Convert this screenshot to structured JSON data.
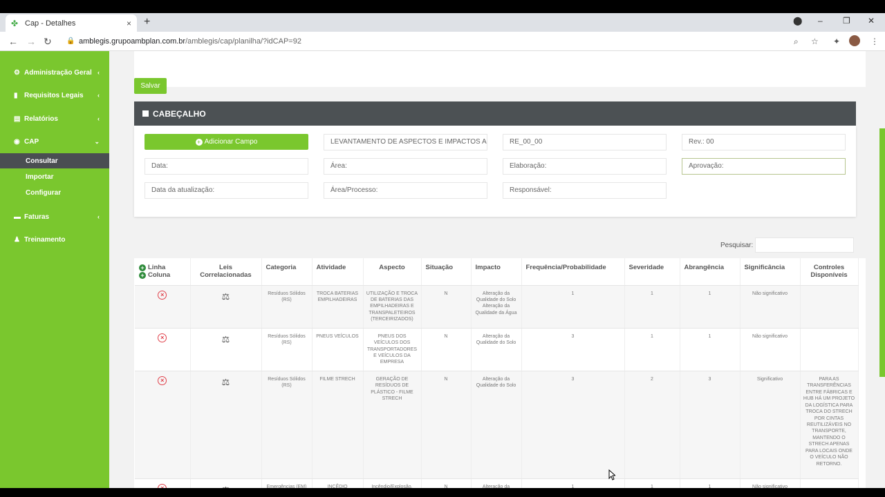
{
  "browser": {
    "tab_title": "Cap - Detalhes",
    "tab_close": "×",
    "new_tab": "+",
    "url_host": "amblegis.grupoambplan.com.br",
    "url_path": "/amblegis/cap/planilha/?idCAP=92",
    "win_min": "–",
    "win_max": "❐",
    "win_close": "✕"
  },
  "sidebar": {
    "items": [
      {
        "label": "Administração Geral",
        "icon": "gear-icon"
      },
      {
        "label": "Requisitos Legais",
        "icon": "bookmark-icon"
      },
      {
        "label": "Relatórios",
        "icon": "report-icon"
      },
      {
        "label": "CAP",
        "icon": "cap-icon"
      },
      {
        "label": "Faturas",
        "icon": "invoice-icon"
      },
      {
        "label": "Treinamento",
        "icon": "user-icon"
      }
    ],
    "cap_sub": [
      "Consultar",
      "Importar",
      "Configurar"
    ]
  },
  "form": {
    "save_label": "Salvar"
  },
  "cabecalho": {
    "title": "CABEÇALHO",
    "add_field_label": "Adicionar Campo",
    "fields": {
      "titulo": "LEVANTAMENTO DE ASPECTOS E IMPACTOS AMBIENTAIS",
      "codigo": "RE_00_00",
      "rev": "Rev.: 00",
      "data": "Data:",
      "area": "Área:",
      "elaboracao": "Elaboração:",
      "aprovacao": "Aprovação:",
      "data_atualizacao": "Data da atualização:",
      "area_processo": "Área/Processo:",
      "responsavel": "Responsável:"
    }
  },
  "table": {
    "search_label": "Pesquisar:",
    "headers": {
      "linha": "Linha",
      "coluna": "Coluna",
      "leis": "Leis Correlacionadas",
      "categoria": "Categoria",
      "atividade": "Atividade",
      "aspecto": "Aspecto",
      "situacao": "Situação",
      "impacto": "Impacto",
      "frequencia": "Frequência/Probabilidade",
      "severidade": "Severidade",
      "abrangencia": "Abrangência",
      "significancia": "Significância",
      "controles": "Controles Disponíveis"
    },
    "rows": [
      {
        "categoria": "Resíduos Sólidos (RS)",
        "atividade": "TROCA BATERIAS EMPILHADEIRAS",
        "aspecto": "UTILIZAÇÃO E TROCA DE BATERIAS DAS EMPILHADEIRAS E TRANSPALETEIROS (TERCEIRIZADOS)",
        "situacao": "N",
        "impacto": "Alteração da Qualidade do Solo Alteração da Qualidade da Água",
        "frequencia": "1",
        "severidade": "1",
        "abrangencia": "1",
        "significancia": "Não significativo",
        "controles": ""
      },
      {
        "categoria": "Resíduos Sólidos (RS)",
        "atividade": "PNEUS VEÍCULOS",
        "aspecto": "PNEUS DOS VEÍCULOS DOS TRANSPORTADORES E VEÍCULOS DA EMPRESA",
        "situacao": "N",
        "impacto": "Alteração da Qualidade do Solo",
        "frequencia": "3",
        "severidade": "1",
        "abrangencia": "1",
        "significancia": "Não significativo",
        "controles": ""
      },
      {
        "categoria": "Resíduos Sólidos (RS)",
        "atividade": "FILME STRECH",
        "aspecto": "GERAÇÃO DE RESÍDUOS DE PLÁSTICO - FILME STRECH",
        "situacao": "N",
        "impacto": "Alteração da Qualidade do Solo",
        "frequencia": "3",
        "severidade": "2",
        "abrangencia": "3",
        "significancia": "Significativo",
        "controles": "PARA AS TRANSFERÊNCIAS ENTRE FÁBRICAS E HUB HÁ UM PROJETO DA LOGÍSTICA PARA TROCA DO STRECH POR CINTAS REUTILIZÁVEIS NO TRANSPORTE, MANTENDO O STRECH APENAS PARA LOCAIS ONDE O VEÍCULO NÃO RETORNO."
      },
      {
        "categoria": "Emergências (EM)",
        "atividade": "INCÊDIO",
        "aspecto": "Incêndio/Explosão, vazamento ou derramamento de",
        "situacao": "N",
        "impacto": "Alteração da Qualidade do Ar, água e solo",
        "frequencia": "1",
        "severidade": "1",
        "abrangencia": "1",
        "significancia": "Não significativo",
        "controles": ""
      }
    ]
  }
}
